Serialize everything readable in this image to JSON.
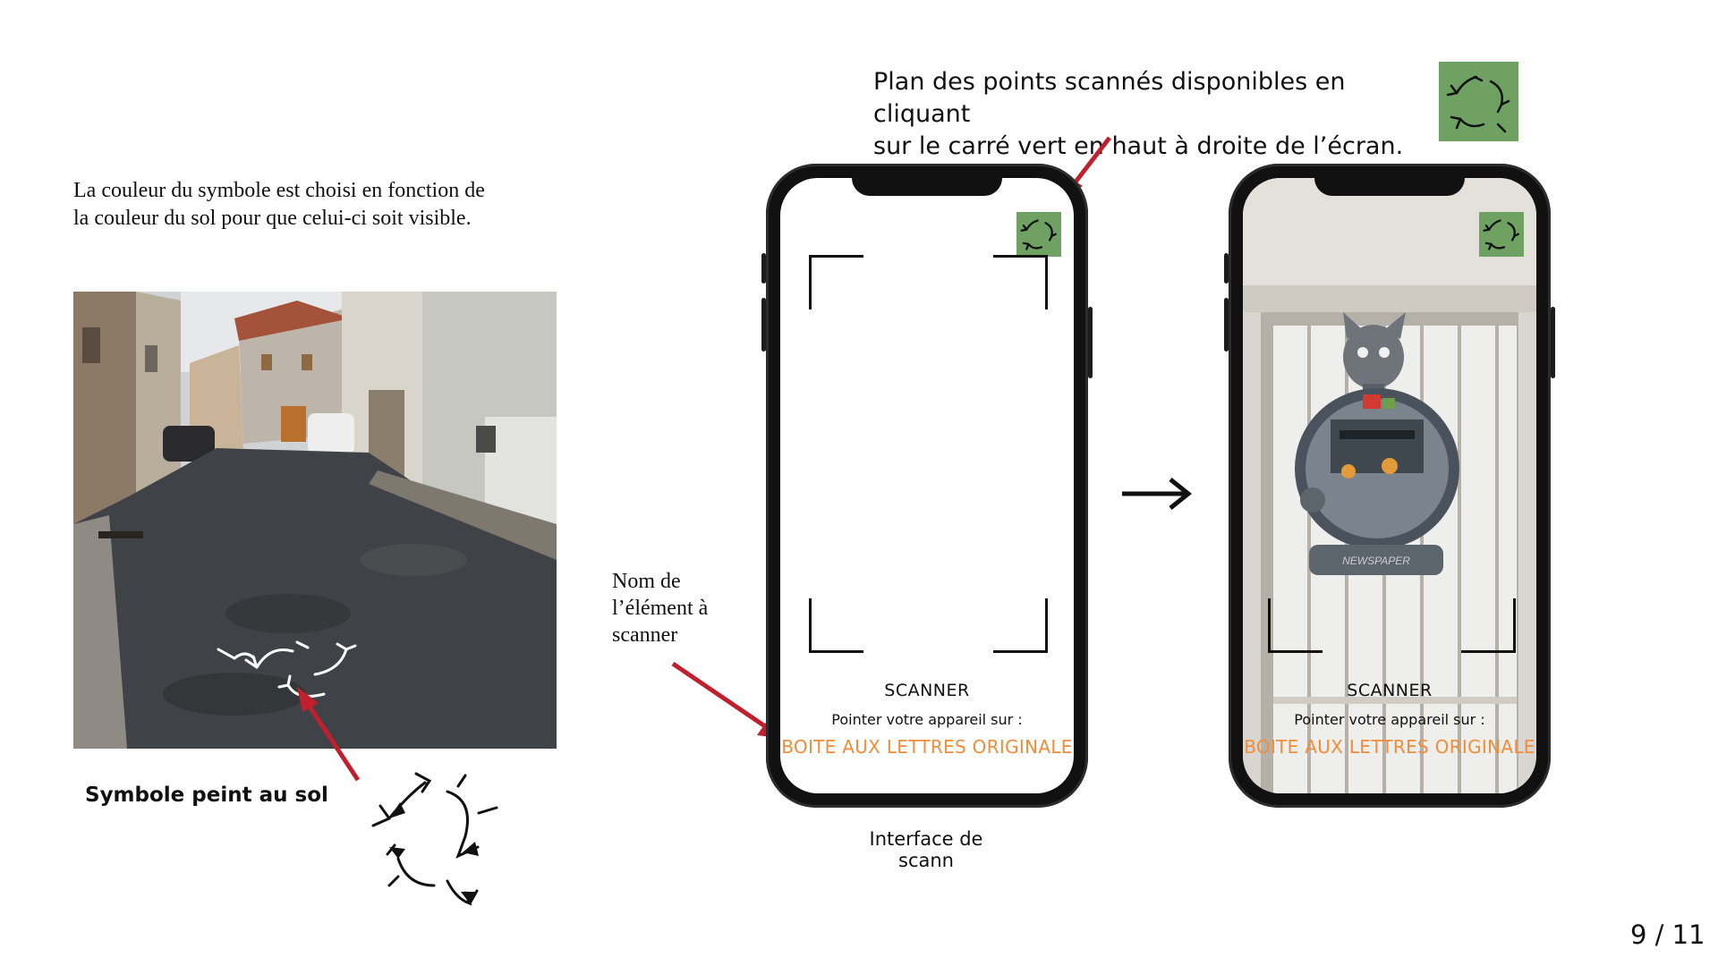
{
  "intro": {
    "line1": "La couleur du symbole est choisi en fonction de",
    "line2": "la couleur du sol pour que celui-ci soit visible."
  },
  "symbol_caption": "Symbole peint au sol",
  "plan_note": {
    "line1": "Plan des points scannés disponibles en cliquant",
    "line2": "sur le carré vert en haut à droite de l’écran."
  },
  "element_label": {
    "line1": "Nom de",
    "line2": "l’élément à",
    "line3": "scanner"
  },
  "scan_screen": {
    "title": "SCANNER",
    "instruction": "Pointer votre appareil sur :",
    "target": "BOITE AUX LETTRES ORIGINALE"
  },
  "result_screen": {
    "title": "SCANNER",
    "instruction": "Pointer votre appareil sur :",
    "target": "BOITE AUX LETTRES ORIGINALE",
    "mailbox_text": "NEWSPAPER"
  },
  "scan_caption": "Interface de scann",
  "page_number": "9 / 11",
  "colors": {
    "accent_orange": "#f08c3a",
    "icon_green": "#6fa163",
    "arrow_red": "#c0202e"
  },
  "icons": {
    "plan_icon": "triple-arrow-symbol-icon",
    "next_arrow": "arrow-right-icon"
  }
}
